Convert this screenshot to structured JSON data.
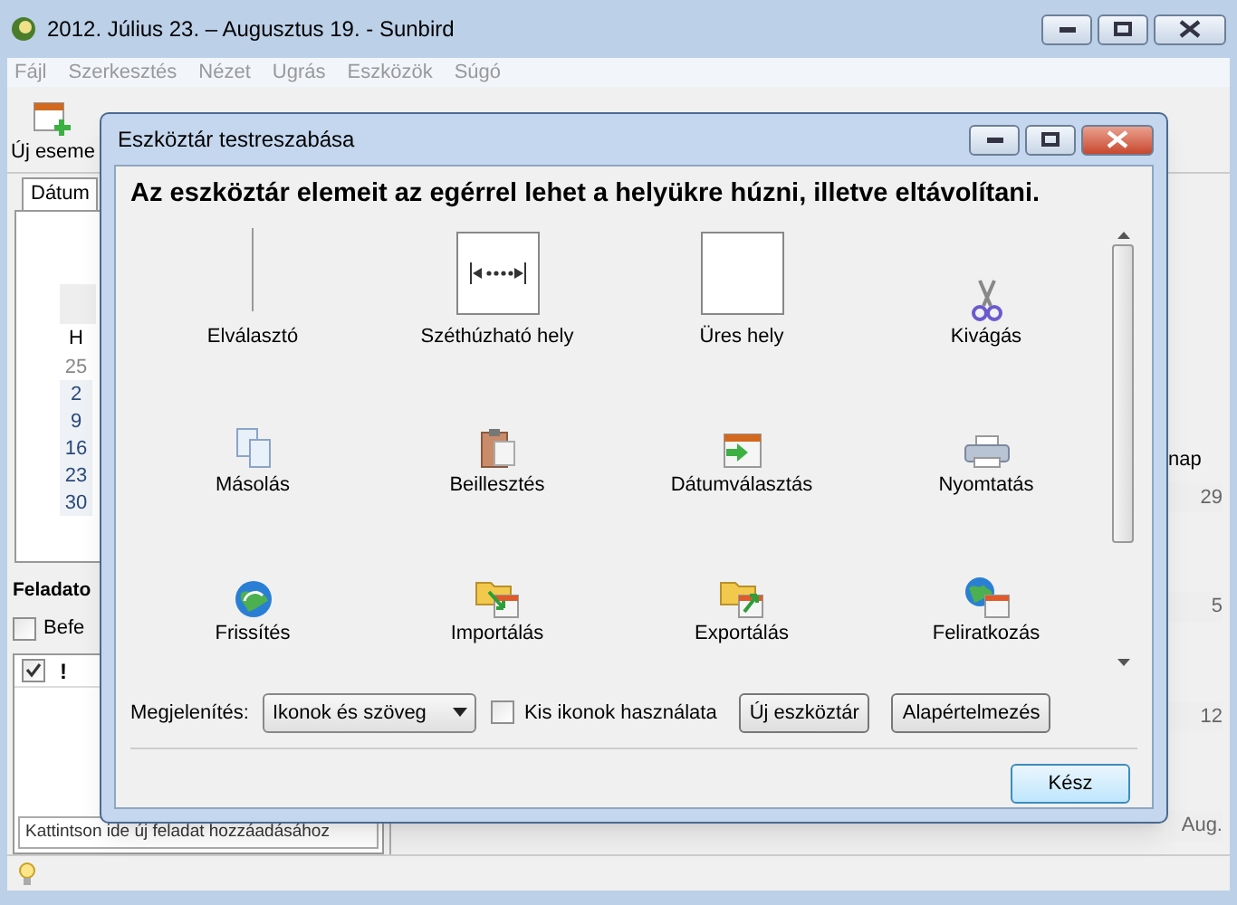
{
  "window": {
    "title": "2012. Július 23. – Augusztus 19. - Sunbird"
  },
  "menu": [
    "Fájl",
    "Szerkesztés",
    "Nézet",
    "Ugrás",
    "Eszközök",
    "Súgó"
  ],
  "toolbar": {
    "first_label": "Új eseme"
  },
  "sidebar": {
    "tab": "Dátum",
    "weekday": "H",
    "days": [
      {
        "label": "25",
        "muted": true
      },
      {
        "label": "2",
        "muted": false
      },
      {
        "label": "9",
        "muted": false
      },
      {
        "label": "16",
        "muted": false
      },
      {
        "label": "23",
        "muted": false
      },
      {
        "label": "30",
        "muted": false
      }
    ],
    "tasks_title": "Feladato",
    "done_column": {
      "checked": true
    },
    "filter": {
      "label": "Befe",
      "checked": false
    },
    "priority_column": "!",
    "new_task": {
      "placeholder": "Kattintson ide új feladat hozzáadásához"
    }
  },
  "calendar": {
    "column_header": "nap",
    "cells": [
      "29",
      "5",
      "12",
      "Aug."
    ]
  },
  "dialog": {
    "title": "Eszköztár testreszabása",
    "heading": "Az eszköztár elemeit az egérrel lehet a helyükre húzni, illetve eltávolítani.",
    "items": [
      {
        "label": "Elválasztó",
        "kind": "separator"
      },
      {
        "label": "Széthúzható hely",
        "kind": "spring"
      },
      {
        "label": "Üres hely",
        "kind": "space"
      },
      {
        "label": "Kivágás",
        "kind": "cut"
      },
      {
        "label": "Másolás",
        "kind": "copy"
      },
      {
        "label": "Beillesztés",
        "kind": "paste"
      },
      {
        "label": "Dátumválasztás",
        "kind": "date"
      },
      {
        "label": "Nyomtatás",
        "kind": "print"
      },
      {
        "label": "Frissítés",
        "kind": "refresh"
      },
      {
        "label": "Importálás",
        "kind": "import"
      },
      {
        "label": "Exportálás",
        "kind": "export"
      },
      {
        "label": "Feliratkozás",
        "kind": "subscribe"
      }
    ],
    "show_label": "Megjelenítés:",
    "show_value": "Ikonok és szöveg",
    "small_icons": {
      "label": "Kis ikonok használata",
      "checked": false
    },
    "buttons": [
      "Új eszköztár",
      "Alapértelmezés"
    ],
    "done": "Kész"
  }
}
